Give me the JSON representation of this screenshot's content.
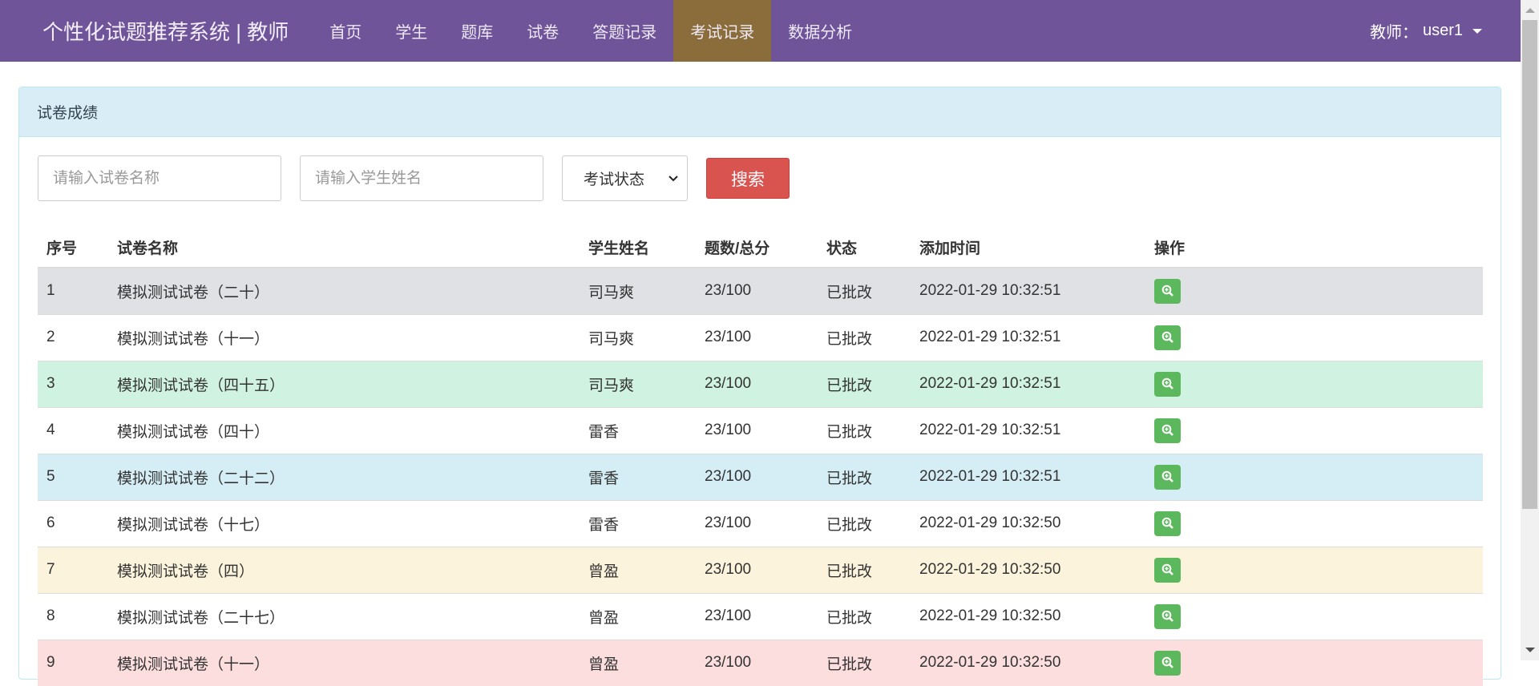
{
  "nav": {
    "brand": "个性化试题推荐系统 | 教师",
    "items": [
      "首页",
      "学生",
      "题库",
      "试卷",
      "答题记录",
      "考试记录",
      "数据分析"
    ],
    "active_index": 5,
    "user_label": "教师：",
    "user_name": "user1"
  },
  "panel": {
    "title": "试卷成绩"
  },
  "filters": {
    "paper_placeholder": "请输入试卷名称",
    "student_placeholder": "请输入学生姓名",
    "status_select": "考试状态",
    "search_label": "搜索"
  },
  "table": {
    "headers": [
      "序号",
      "试卷名称",
      "学生姓名",
      "题数/总分",
      "状态",
      "添加时间",
      "操作"
    ],
    "rows": [
      {
        "no": "1",
        "paper": "模拟测试试卷（二十）",
        "student": "司马爽",
        "score": "23/100",
        "status": "已批改",
        "time": "2022-01-29 10:32:51",
        "style": "active"
      },
      {
        "no": "2",
        "paper": "模拟测试试卷（十一）",
        "student": "司马爽",
        "score": "23/100",
        "status": "已批改",
        "time": "2022-01-29 10:32:51",
        "style": ""
      },
      {
        "no": "3",
        "paper": "模拟测试试卷（四十五）",
        "student": "司马爽",
        "score": "23/100",
        "status": "已批改",
        "time": "2022-01-29 10:32:51",
        "style": "success"
      },
      {
        "no": "4",
        "paper": "模拟测试试卷（四十）",
        "student": "雷香",
        "score": "23/100",
        "status": "已批改",
        "time": "2022-01-29 10:32:51",
        "style": ""
      },
      {
        "no": "5",
        "paper": "模拟测试试卷（二十二）",
        "student": "雷香",
        "score": "23/100",
        "status": "已批改",
        "time": "2022-01-29 10:32:51",
        "style": "info"
      },
      {
        "no": "6",
        "paper": "模拟测试试卷（十七）",
        "student": "雷香",
        "score": "23/100",
        "status": "已批改",
        "time": "2022-01-29 10:32:50",
        "style": ""
      },
      {
        "no": "7",
        "paper": "模拟测试试卷（四）",
        "student": "曾盈",
        "score": "23/100",
        "status": "已批改",
        "time": "2022-01-29 10:32:50",
        "style": "warning"
      },
      {
        "no": "8",
        "paper": "模拟测试试卷（二十七）",
        "student": "曾盈",
        "score": "23/100",
        "status": "已批改",
        "time": "2022-01-29 10:32:50",
        "style": ""
      },
      {
        "no": "9",
        "paper": "模拟测试试卷（十一）",
        "student": "曾盈",
        "score": "23/100",
        "status": "已批改",
        "time": "2022-01-29 10:32:50",
        "style": "danger"
      }
    ]
  },
  "icons": {
    "action": "zoom-in-icon"
  }
}
